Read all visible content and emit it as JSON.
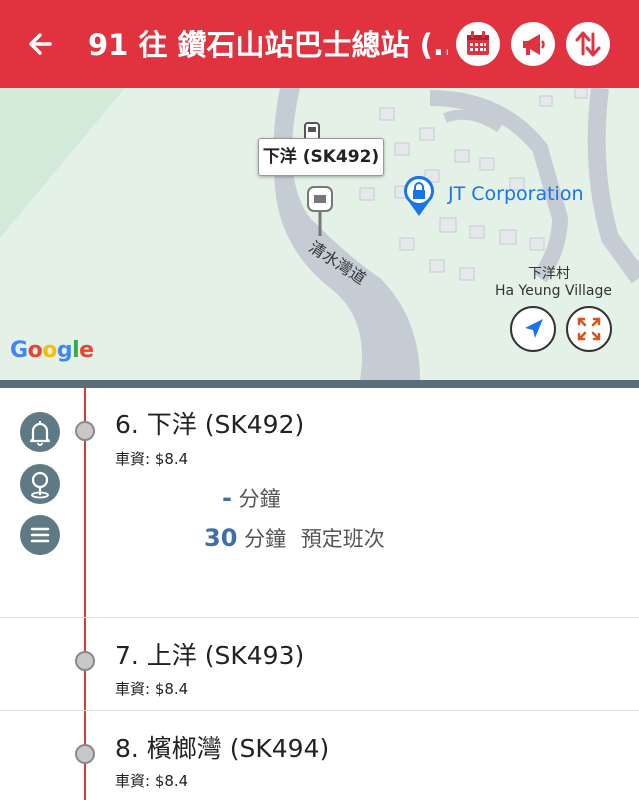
{
  "header": {
    "title": "91 往 鑽石山站巴士總站 (...",
    "icons": [
      "back-arrow-icon",
      "calendar-icon",
      "megaphone-icon",
      "swap-direction-icon"
    ],
    "color": "#e0323f"
  },
  "map": {
    "callout": "下洋 (SK492)",
    "road_label": "清水灣道",
    "poi_label": "JT Corporation",
    "village_label_zh": "下洋村",
    "village_label_en": "Ha Yeung Village",
    "attribution": "Google"
  },
  "stops": [
    {
      "name": "6. 下洋 (SK492)",
      "fare": "車資: $8.4"
    },
    {
      "name": "7. 上洋 (SK493)",
      "fare": "車資: $8.4"
    },
    {
      "name": "8. 檳榔灣 (SK494)",
      "fare": "車資: $8.4"
    }
  ],
  "eta": [
    {
      "value": "-",
      "unit": "分鐘",
      "note": ""
    },
    {
      "value": "30",
      "unit": "分鐘",
      "note": "預定班次"
    }
  ]
}
